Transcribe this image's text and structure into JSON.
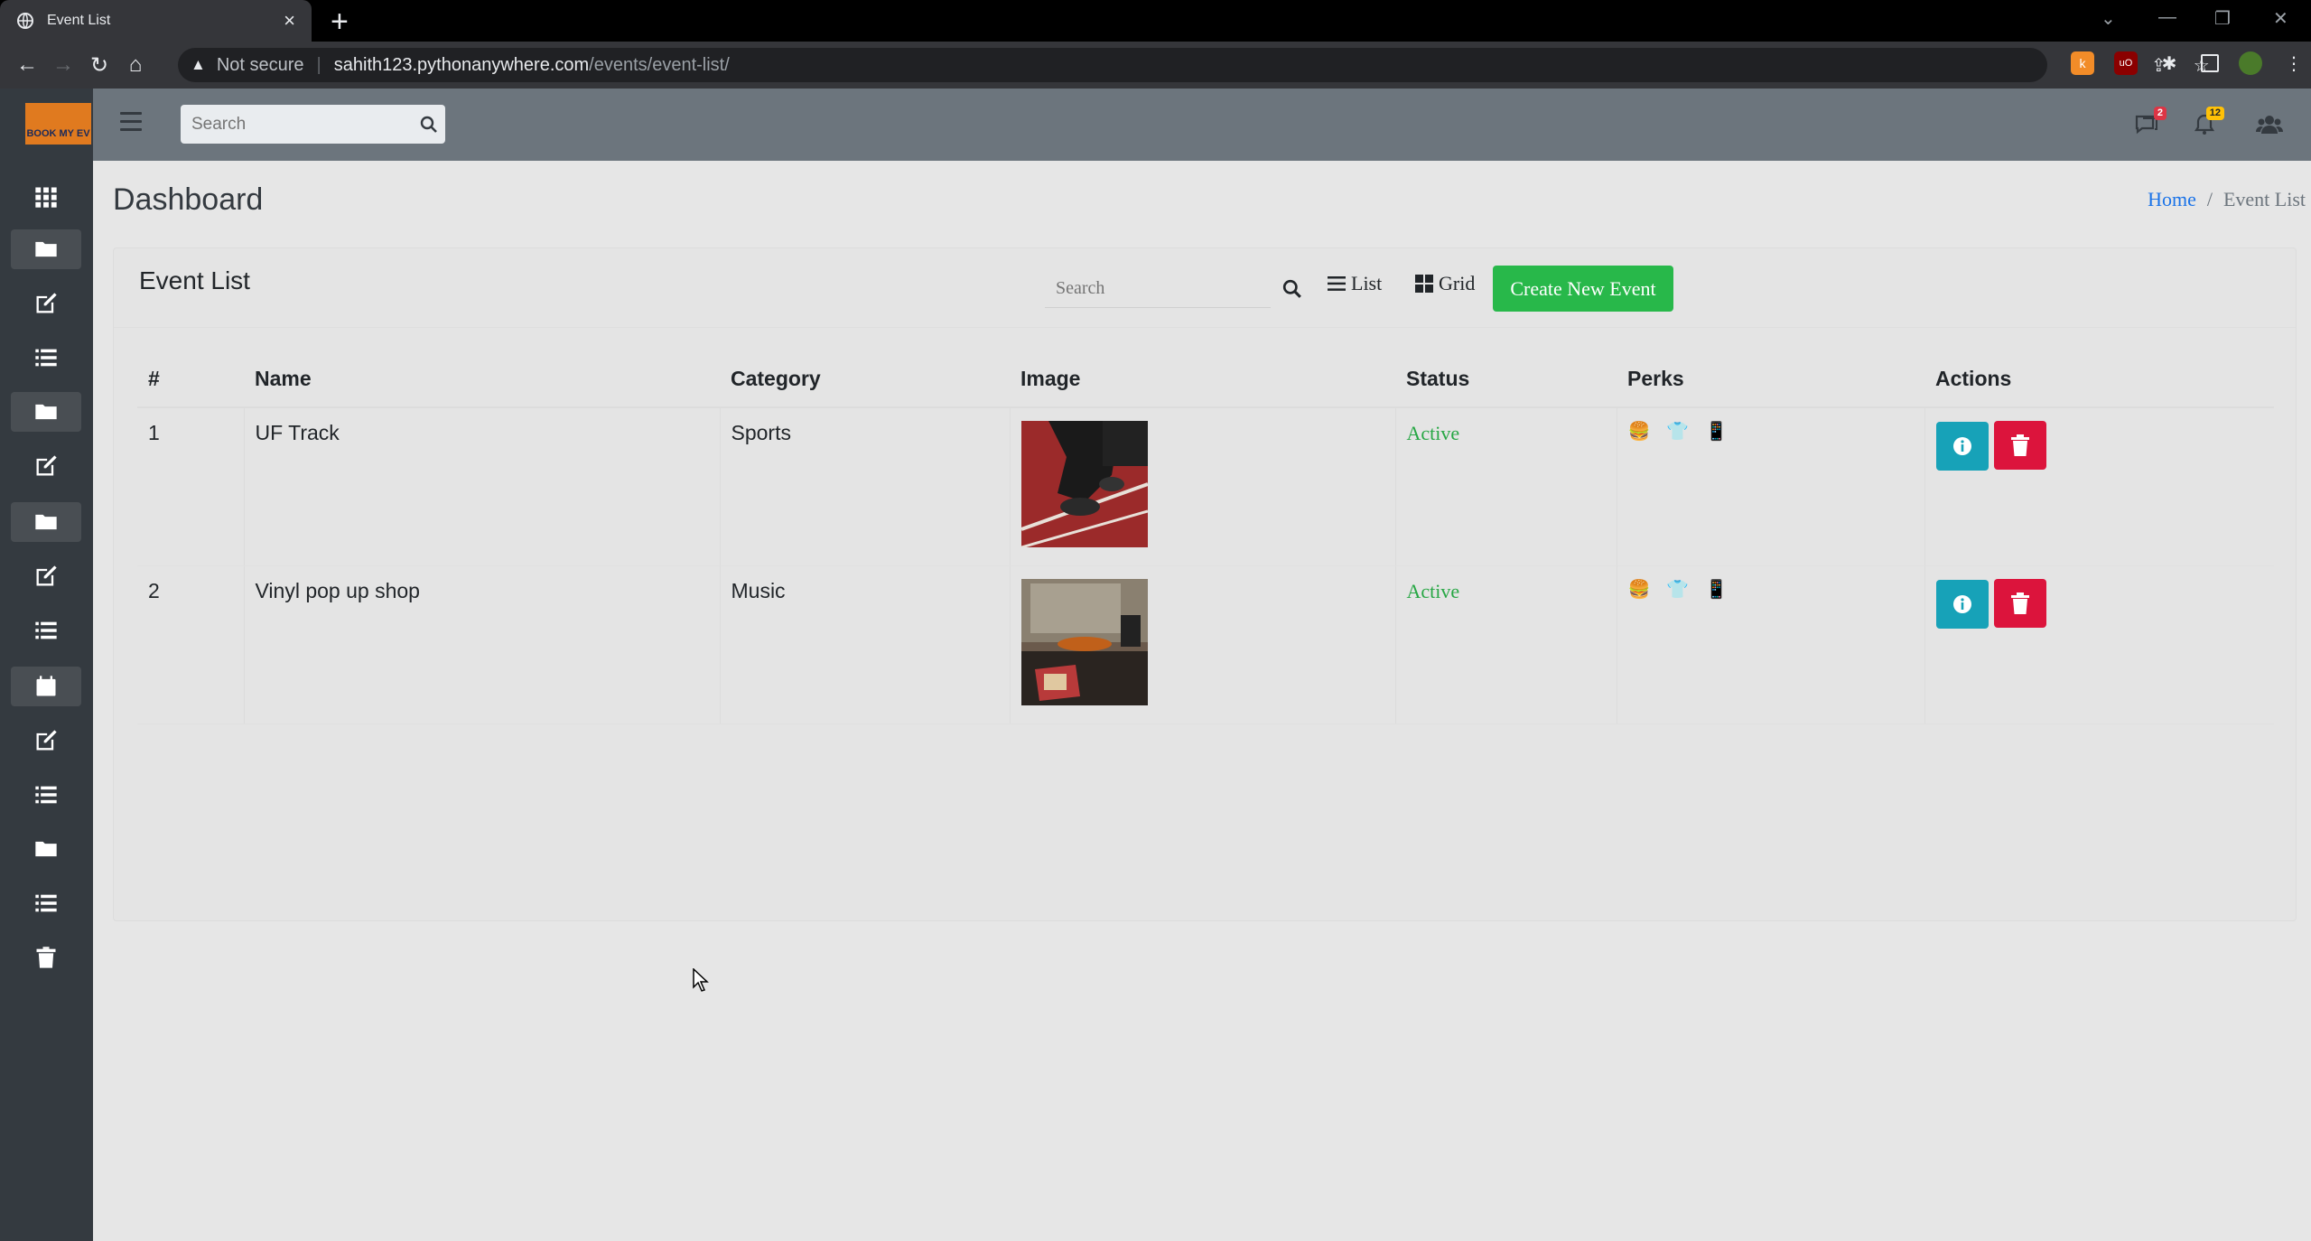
{
  "browser": {
    "tab_title": "Event List",
    "security_label": "Not secure",
    "url_host": "sahith123.pythonanywhere.com",
    "url_path": "/events/event-list/"
  },
  "app": {
    "logo_text": "BOOK MY EV",
    "search_placeholder": "Search",
    "messages_badge": "2",
    "notifications_badge": "12"
  },
  "sidebar": {
    "items": [
      {
        "icon": "grid-icon"
      },
      {
        "icon": "folder-icon"
      },
      {
        "icon": "edit-icon"
      },
      {
        "icon": "list-icon"
      },
      {
        "icon": "folder-icon"
      },
      {
        "icon": "edit-icon"
      },
      {
        "icon": "folder-icon"
      },
      {
        "icon": "edit-icon"
      },
      {
        "icon": "list-icon"
      },
      {
        "icon": "calendar-icon"
      },
      {
        "icon": "edit-icon"
      },
      {
        "icon": "list-icon"
      },
      {
        "icon": "folder-icon"
      },
      {
        "icon": "list-icon"
      },
      {
        "icon": "trash-icon"
      }
    ]
  },
  "page": {
    "title": "Dashboard",
    "breadcrumb_home": "Home",
    "breadcrumb_separator": "/",
    "breadcrumb_current": "Event List"
  },
  "card": {
    "title": "Event List",
    "search_placeholder": "Search",
    "list_label": "List",
    "grid_label": "Grid",
    "create_label": "Create New Event"
  },
  "table": {
    "headers": [
      "#",
      "Name",
      "Category",
      "Image",
      "Status",
      "Perks",
      "Actions"
    ],
    "rows": [
      {
        "num": "1",
        "name": "UF Track",
        "category": "Sports",
        "image": "track-runner-photo",
        "status": "Active",
        "perks": [
          "burger-icon",
          "tshirt-icon",
          "tablet-icon"
        ]
      },
      {
        "num": "2",
        "name": "Vinyl pop up shop",
        "category": "Music",
        "image": "vinyl-shop-photo",
        "status": "Active",
        "perks": [
          "burger-icon",
          "tshirt-icon",
          "tablet-icon"
        ]
      }
    ]
  },
  "colors": {
    "sidebar": "#343a40",
    "topnav": "#6c757d",
    "create_button": "#28b84a",
    "info_button": "#17a2b8",
    "delete_button": "#dc143c",
    "status_active": "#28a745",
    "link": "#1a73e8"
  }
}
